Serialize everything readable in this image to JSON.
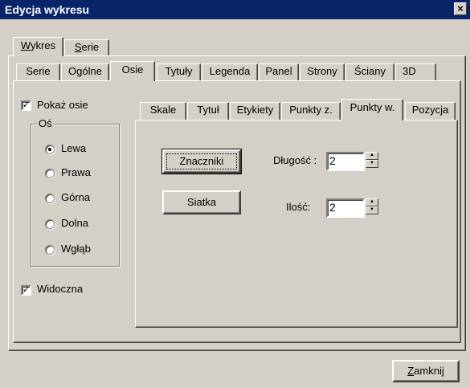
{
  "window": {
    "title": "Edycja wykresu",
    "close_glyph": "×"
  },
  "top_tabs": [
    {
      "pre": "",
      "u": "W",
      "post": "ykres"
    },
    {
      "pre": "",
      "u": "S",
      "post": "erie"
    }
  ],
  "second_tabs": [
    "Serie",
    "Ogólne",
    "Osie",
    "Tytuły",
    "Legenda",
    "Panel",
    "Strony",
    "Ściany",
    "3D"
  ],
  "axis_panel": {
    "show_axes_label": "Pokaż osie",
    "show_axes_checked": true,
    "group_title": "Oś",
    "options": [
      "Lewa",
      "Prawa",
      "Górna",
      "Dolna",
      "Wgłąb"
    ],
    "selected": "Lewa",
    "visible_label": "Widoczna",
    "visible_checked": true
  },
  "inner_tabs": [
    "Skale",
    "Tytuł",
    "Etykiety",
    "Punkty z.",
    "Punkty w.",
    "Pozycja"
  ],
  "ticks": {
    "markers_button": "Znaczniki",
    "grid_button": "Siatka",
    "length_label": "Długość :",
    "length_value": "2",
    "count_label": "Ilość:",
    "count_value": "2"
  },
  "footer": {
    "close_pre": "",
    "close_u": "Z",
    "close_post": "amknij"
  },
  "colors": {
    "titlebar": "#0a246a",
    "face": "#d4d0c8"
  }
}
